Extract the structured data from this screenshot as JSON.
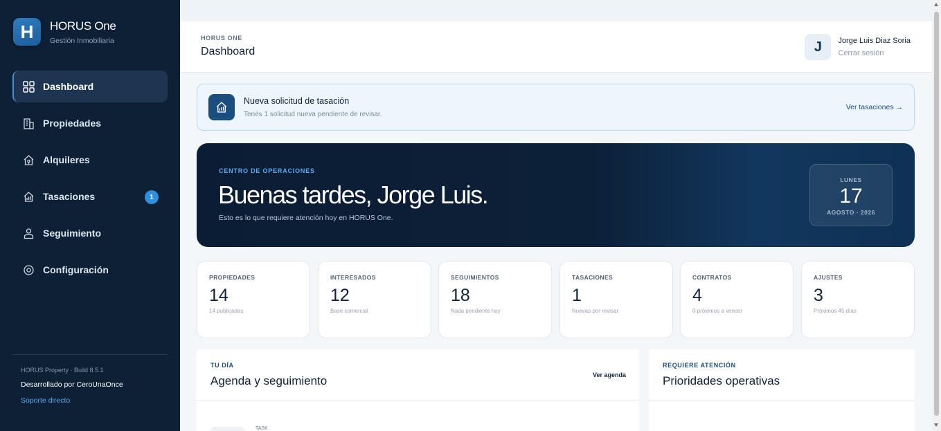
{
  "brand": {
    "logo_letter": "H",
    "title": "HORUS One",
    "subtitle": "Gestión Inmobiliaria"
  },
  "sidebar": {
    "items": [
      {
        "label": "Dashboard",
        "icon": "grid-icon",
        "active": true
      },
      {
        "label": "Propiedades",
        "icon": "building-icon"
      },
      {
        "label": "Alquileres",
        "icon": "house-key-icon"
      },
      {
        "label": "Tasaciones",
        "icon": "house-chart-icon",
        "badge": "1"
      },
      {
        "label": "Seguimiento",
        "icon": "person-icon"
      },
      {
        "label": "Configuración",
        "icon": "gear-icon"
      }
    ],
    "footer": {
      "build": "HORUS Property · Build 8.5.1",
      "developer": "Desarrollado por CeroUnaOnce",
      "support": "Soporte directo"
    }
  },
  "header": {
    "kicker": "HORUS ONE",
    "title": "Dashboard",
    "user": {
      "initial": "J",
      "name": "Jorge Luis Diaz Soria",
      "logout": "Cerrar sesión"
    }
  },
  "notice": {
    "title": "Nueva solicitud de tasación",
    "subtitle": "Tenés 1 solicitud nueva pendiente de revisar.",
    "link": "Ver tasaciones →"
  },
  "hero": {
    "kicker": "CENTRO DE OPERACIONES",
    "greeting": "Buenas tardes, Jorge Luis.",
    "subtitle": "Esto es lo que requiere atención hoy en HORUS One.",
    "date": {
      "weekday": "LUNES",
      "day": "17",
      "month_year": "AGOSTO · 2026"
    }
  },
  "stats": [
    {
      "label": "PROPIEDADES",
      "value": "14",
      "note": "14 publicadas"
    },
    {
      "label": "INTERESADOS",
      "value": "12",
      "note": "Base comercial"
    },
    {
      "label": "SEGUIMIENTOS",
      "value": "18",
      "note": "Nada pendiente hoy"
    },
    {
      "label": "TASACIONES",
      "value": "1",
      "note": "Nuevas por revisar"
    },
    {
      "label": "CONTRATOS",
      "value": "4",
      "note": "0 próximos a vencer"
    },
    {
      "label": "AJUSTES",
      "value": "3",
      "note": "Próximos 45 días"
    }
  ],
  "agenda_panel": {
    "kicker": "TU DÍA",
    "title": "Agenda y seguimiento",
    "link": "Ver agenda",
    "first_item_type": "TASK"
  },
  "priorities_panel": {
    "kicker": "REQUIERE ATENCIÓN",
    "title": "Prioridades operativas"
  },
  "colors": {
    "sidebar_bg": "#0d2036",
    "accent": "#2f8fdc",
    "hero_bg": "#0b1d34"
  }
}
